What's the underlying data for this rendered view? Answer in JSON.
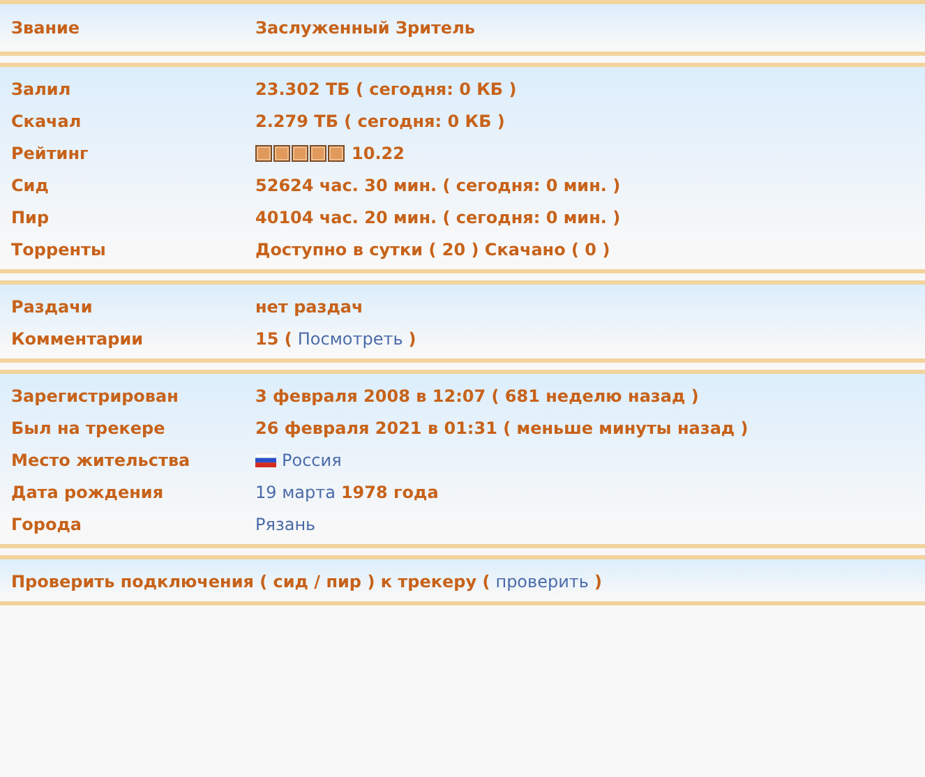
{
  "sections": [
    {
      "rows": [
        {
          "label": "Звание",
          "value": [
            {
              "kind": "text",
              "text": "Заслуженный Зритель"
            }
          ]
        }
      ]
    },
    {
      "rows": [
        {
          "label": "Залил",
          "value": [
            {
              "kind": "text",
              "text": "23.302 ТБ ( сегодня: 0 КБ )"
            }
          ]
        },
        {
          "label": "Скачал",
          "value": [
            {
              "kind": "text",
              "text": "2.279 ТБ ( сегодня: 0 КБ )"
            }
          ]
        },
        {
          "label": "Рейтинг",
          "stars": 5,
          "value": [
            {
              "kind": "text",
              "text": "10.22"
            }
          ]
        },
        {
          "label": "Сид",
          "value": [
            {
              "kind": "text",
              "text": "52624 час. 30 мин. ( сегодня: 0 мин. )"
            }
          ]
        },
        {
          "label": "Пир",
          "value": [
            {
              "kind": "text",
              "text": "40104 час. 20 мин. ( сегодня: 0 мин. )"
            }
          ]
        },
        {
          "label": "Торренты",
          "value": [
            {
              "kind": "text",
              "text": "Доступно в сутки ( 20 ) Скачано ( 0 )"
            }
          ]
        }
      ]
    },
    {
      "rows": [
        {
          "label": "Раздачи",
          "value": [
            {
              "kind": "text",
              "text": "нет раздач"
            }
          ]
        },
        {
          "label": "Комментарии",
          "value": [
            {
              "kind": "text",
              "text": "15 ("
            },
            {
              "kind": "link",
              "text": "Посмотреть"
            },
            {
              "kind": "text",
              "text": ")"
            }
          ]
        }
      ]
    },
    {
      "rows": [
        {
          "label": "Зарегистрирован",
          "value": [
            {
              "kind": "text",
              "text": "3 февраля 2008 в 12:07 ( 681 неделю назад )"
            }
          ]
        },
        {
          "label": "Был на трекере",
          "value": [
            {
              "kind": "text",
              "text": "26 февраля 2021 в 01:31 ( меньше минуты назад )"
            }
          ]
        },
        {
          "label": "Место жительства",
          "flag": true,
          "value": [
            {
              "kind": "link",
              "text": "Россия"
            }
          ]
        },
        {
          "label": "Дата рождения",
          "value": [
            {
              "kind": "link",
              "text": "19 марта"
            },
            {
              "kind": "text",
              "text": "1978 года"
            }
          ]
        },
        {
          "label": "Города",
          "value": [
            {
              "kind": "link",
              "text": "Рязань"
            }
          ]
        }
      ]
    },
    {
      "rows": [
        {
          "value": [
            {
              "kind": "text",
              "text": "Проверить подключения ( сид / пир ) к трекеру ("
            },
            {
              "kind": "link",
              "text": "проверить"
            },
            {
              "kind": "text",
              "text": ")"
            }
          ]
        }
      ]
    }
  ]
}
